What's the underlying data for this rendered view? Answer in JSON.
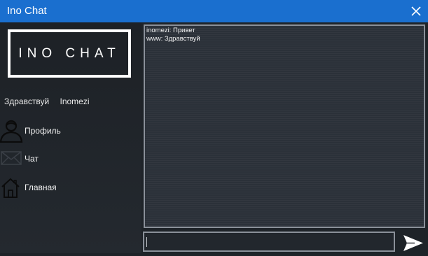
{
  "window": {
    "title": "Ino Chat",
    "accent_color": "#1a6fcf",
    "close_icon": "close-icon"
  },
  "sidebar": {
    "logo_text": "INO CHAT",
    "greeting": "Здравствуй",
    "username": "Inomezi",
    "items": [
      {
        "label": "Профиль",
        "icon": "user-icon"
      },
      {
        "label": "Чат",
        "icon": "envelope-icon"
      },
      {
        "label": "Главная",
        "icon": "home-icon"
      }
    ]
  },
  "chat": {
    "messages": [
      {
        "text": "inomezi: Привет"
      },
      {
        "text": "www: Здравствуй"
      }
    ]
  },
  "composer": {
    "value": "",
    "placeholder": "",
    "send_icon": "send-icon"
  }
}
